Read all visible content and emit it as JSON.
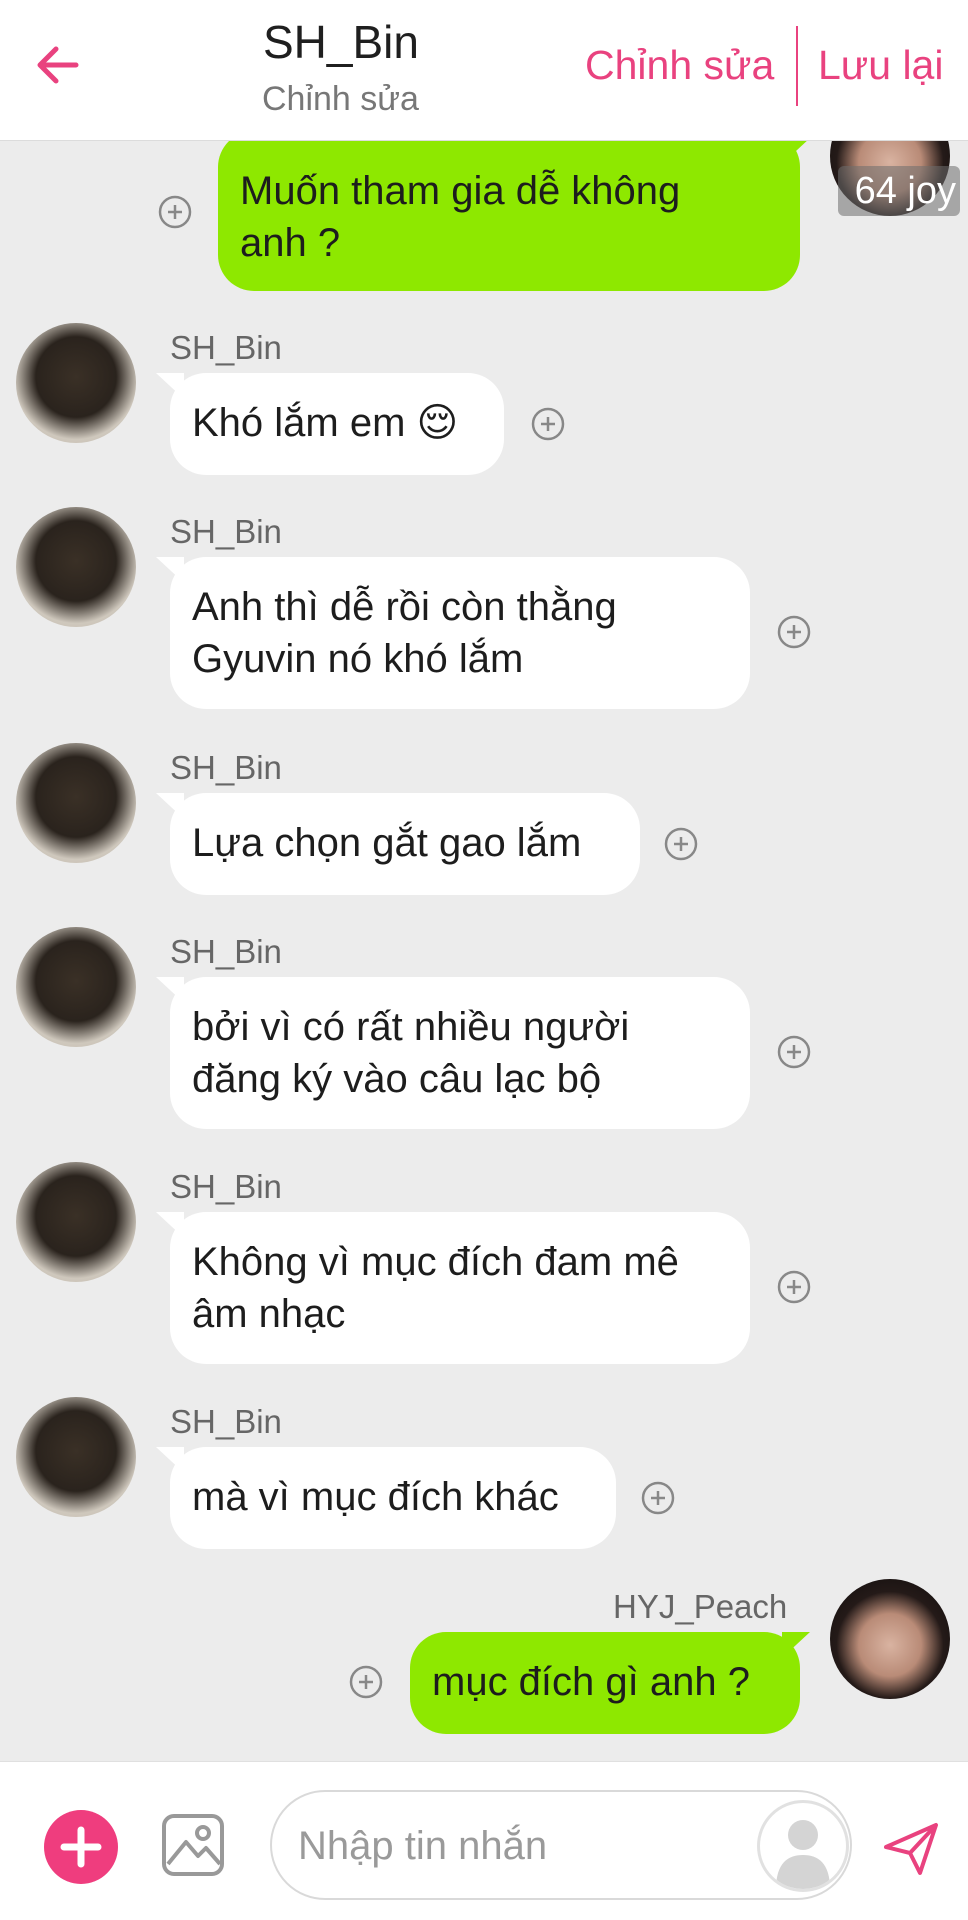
{
  "header": {
    "title": "SH_Bin",
    "subtitle": "Chỉnh sửa",
    "edit_label": "Chỉnh sửa",
    "save_label": "Lưu lại"
  },
  "messages": [
    {
      "direction": "out",
      "line1": "Muốn tham gia dễ không",
      "line2": "anh ?"
    },
    {
      "direction": "in",
      "sender": "SH_Bin",
      "text": "Khó lắm em 😌"
    },
    {
      "direction": "in",
      "sender": "SH_Bin",
      "line1": "Anh thì dễ rồi còn thằng",
      "line2": "Gyuvin nó khó lắm"
    },
    {
      "direction": "in",
      "sender": "SH_Bin",
      "text": "Lựa chọn gắt gao lắm"
    },
    {
      "direction": "in",
      "sender": "SH_Bin",
      "line1": "bởi vì có rất nhiều người",
      "line2": "đăng ký vào câu lạc bộ"
    },
    {
      "direction": "in",
      "sender": "SH_Bin",
      "line1": "Không vì mục đích đam mê",
      "line2": "âm nhạc"
    },
    {
      "direction": "in",
      "sender": "SH_Bin",
      "text": "mà vì mục đích khác"
    },
    {
      "direction": "out",
      "sender": "HYJ_Peach",
      "text": "mục đích gì anh ?"
    }
  ],
  "badge": {
    "text": "64 joy"
  },
  "input": {
    "placeholder": "Nhập tin nhắn"
  },
  "icons": {
    "back": "arrow-left-icon",
    "plus": "plus-circle-icon",
    "add": "plus-icon",
    "image": "image-icon",
    "send": "send-icon",
    "avatar_placeholder": "user-silhouette-icon"
  },
  "colors": {
    "accent": "#e9427f",
    "outgoing_bubble": "#8ee800",
    "incoming_bubble": "#ffffff",
    "chat_background": "#ececec"
  }
}
